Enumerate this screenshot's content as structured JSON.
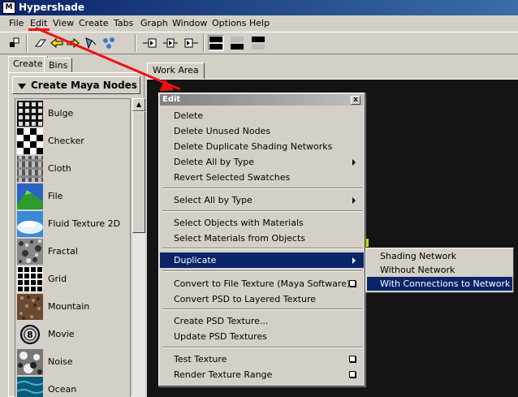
{
  "window": {
    "title": "Hypershade",
    "icon": "maya-logo-icon"
  },
  "menubar": [
    "File",
    "Edit",
    "View",
    "Create",
    "Tabs",
    "Graph",
    "Window",
    "Options",
    "Help"
  ],
  "toolbar_icons": [
    "node-icon",
    "eraser-icon",
    "arrow-left-icon",
    "arrow-right-icon",
    "network-icon",
    "graph-icon",
    "graph-upstream-icon",
    "graph-downstream-icon",
    "graph-input-output-icon",
    "layout-top-icon",
    "layout-bottom-icon",
    "layout-single-icon"
  ],
  "left_tabs": [
    "Create",
    "Bins"
  ],
  "create_header": "Create Maya Nodes",
  "nodes": [
    {
      "label": "Bulge",
      "icon": "bulge-swatch"
    },
    {
      "label": "Checker",
      "icon": "checker-swatch"
    },
    {
      "label": "Cloth",
      "icon": "cloth-swatch"
    },
    {
      "label": "File",
      "icon": "file-swatch"
    },
    {
      "label": "Fluid Texture 2D",
      "icon": "fluid-texture-swatch"
    },
    {
      "label": "Fractal",
      "icon": "fractal-swatch"
    },
    {
      "label": "Grid",
      "icon": "grid-swatch"
    },
    {
      "label": "Mountain",
      "icon": "mountain-swatch"
    },
    {
      "label": "Movie",
      "icon": "movie-swatch"
    },
    {
      "label": "Noise",
      "icon": "noise-swatch"
    },
    {
      "label": "Ocean",
      "icon": "ocean-swatch"
    }
  ],
  "work_tab": "Work Area",
  "edit_menu": {
    "title": "Edit",
    "close": "x",
    "items": [
      {
        "label": "Delete"
      },
      {
        "label": "Delete Unused Nodes"
      },
      {
        "label": "Delete Duplicate Shading Networks"
      },
      {
        "label": "Delete All by Type"
      },
      {
        "label": "Revert Selected Swatches"
      },
      {
        "label": "Select All by Type"
      },
      {
        "label": "Select Objects with Materials"
      },
      {
        "label": "Select Materials from Objects"
      },
      {
        "label": "Duplicate"
      },
      {
        "label": "Convert to File Texture (Maya Software)"
      },
      {
        "label": "Convert PSD to Layered Texture"
      },
      {
        "label": "Create PSD Texture..."
      },
      {
        "label": "Update PSD Textures"
      },
      {
        "label": "Test Texture"
      },
      {
        "label": "Render Texture Range"
      }
    ]
  },
  "duplicate_submenu": [
    "Shading Network",
    "Without Network",
    "With Connections to Network"
  ],
  "colors": {
    "highlight": "#0a246a",
    "annotation": "#ee1111",
    "workarea": "#141414"
  }
}
